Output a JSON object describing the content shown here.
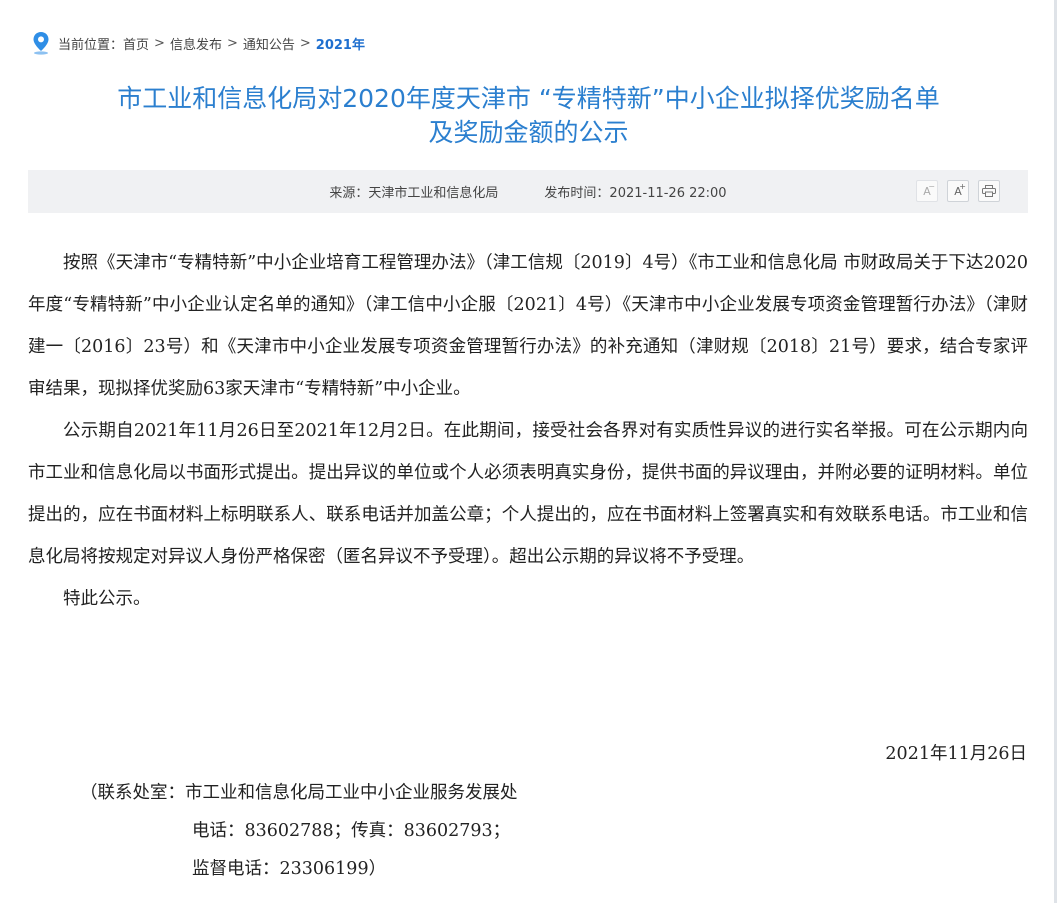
{
  "breadcrumb": {
    "prefix": "当前位置：",
    "items": [
      "首页",
      "信息发布",
      "通知公告"
    ],
    "current": "2021年",
    "separator": ">"
  },
  "article": {
    "title_line1": "市工业和信息化局对2020年度天津市 “专精特新”中小企业拟择优奖励名单",
    "title_line2": "及奖励金额的公示",
    "source": "来源：天津市工业和信息化局",
    "publish_time": "发布时间：2021-11-26 22:00",
    "tools": {
      "font_smaller": "A",
      "font_larger": "A",
      "print_icon": "printer-icon"
    },
    "paragraphs": [
      "按照《天津市“专精特新”中小企业培育工程管理办法》（津工信规〔2019〕4号）《市工业和信息化局 市财政局关于下达2020年度“专精特新”中小企业认定名单的通知》（津工信中小企服〔2021〕4号）《天津市中小企业发展专项资金管理暂行办法》（津财建一〔2016〕23号）和《天津市中小企业发展专项资金管理暂行办法》的补充通知（津财规〔2018〕21号）要求，结合专家评审结果，现拟择优奖励63家天津市“专精特新”中小企业。",
      "公示期自2021年11月26日至2021年12月2日。在此期间，接受社会各界对有实质性异议的进行实名举报。可在公示期内向市工业和信息化局以书面形式提出。提出异议的单位或个人必须表明真实身份，提供书面的异议理由，并附必要的证明材料。单位提出的，应在书面材料上标明联系人、联系电话并加盖公章；个人提出的，应在书面材料上签署真实和有效联系电话。市工业和信息化局将按规定对异议人身份严格保密（匿名异议不予受理）。超出公示期的异议将不予受理。",
      "特此公示。"
    ],
    "date": "2021年11月26日",
    "contact": {
      "office": "（联系处室：市工业和信息化局工业中小企业服务发展处",
      "phone": "电话：83602788；传真：83602793；",
      "supervise": "监督电话：23306199）"
    }
  },
  "colors": {
    "title": "#2b7fcf",
    "breadcrumb_current": "#1f6fcf",
    "meta_bar_bg": "#f0f1f3"
  }
}
